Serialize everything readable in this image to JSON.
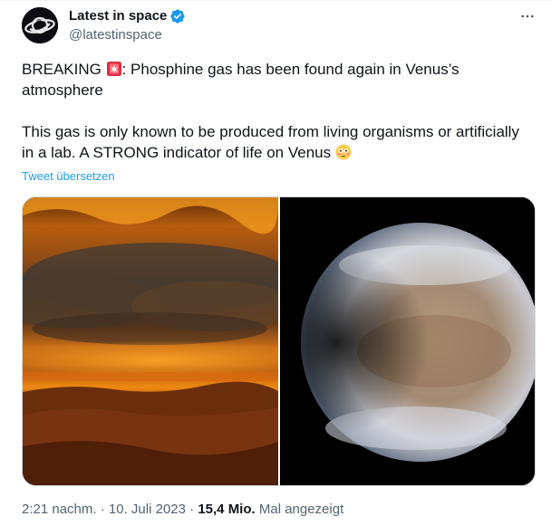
{
  "author": {
    "display_name": "Latest in space",
    "handle": "@latestinspace",
    "verified": true
  },
  "tweet": {
    "line1_prefix": "BREAKING ",
    "line1_emoji": "rotating-light-emoji",
    "line1_suffix": ": Phosphine gas has been found again in Venus’s atmosphere",
    "line2": "This gas is only known to be produced from living organisms or artificially in a lab. A STRONG indicator of life on Venus ",
    "line2_emoji": "flushed-face-emoji",
    "translate_label": "Tweet übersetzen"
  },
  "media": {
    "left_image": "venus-surface-orange-clouds",
    "right_image": "venus-planet-on-black"
  },
  "meta": {
    "time": "2:21 nachm.",
    "sep1": " · ",
    "date": "10. Juli 2023",
    "sep2": " · ",
    "views_count": "15,4 Mio.",
    "views_label": " Mal angezeigt"
  },
  "colors": {
    "link": "#1d9bf0",
    "verified": "#1d9bf0",
    "secondary_text": "#536471"
  }
}
